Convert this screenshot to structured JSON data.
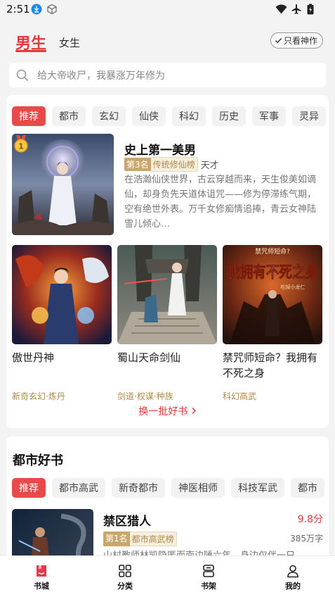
{
  "status_bar": {
    "time": "2:51"
  },
  "header": {
    "tab_male": "男生",
    "tab_female": "女生",
    "only_classics_button": "只看神作"
  },
  "search": {
    "placeholder": "给大帝收尸，我暴涨万年修为"
  },
  "recommend": {
    "categories": [
      "推荐",
      "都市",
      "玄幻",
      "仙侠",
      "科幻",
      "历史",
      "军事",
      "灵异"
    ],
    "featured": {
      "title": "史上第一美男",
      "rank": "第3名",
      "rank_list": "传统修仙榜",
      "author": "天才",
      "description": "在浩瀚仙侠世界，古云穿越而来，天生俊美如谪仙，却身负先天道体诅咒——修为停滞练气期，空有绝世外表。万千女修痴情追捧，青云女神陆雪儿倾心…",
      "rank_number": "1"
    },
    "books": [
      {
        "name": "傲世丹神",
        "tag": "新奇玄幻·炼丹"
      },
      {
        "name": "蜀山天命剑仙",
        "tag": "剑道·权谋·种族"
      },
      {
        "name": "禁咒师短命？我拥有不死之身",
        "tag": "科幻高武",
        "cover_text": "我拥有不死之身",
        "cover_subtext": "禁咒师短命?",
        "cover_author": "吃掉小龙仁"
      }
    ],
    "more_link": "换一批好书"
  },
  "urban": {
    "section_title": "都市好书",
    "categories": [
      "推荐",
      "都市高武",
      "新奇都市",
      "神医相师",
      "科技军武",
      "都市"
    ],
    "book": {
      "title": "禁区猎人",
      "score": "9.8分",
      "rank": "第1名",
      "rank_list": "都市高武榜",
      "words": "385万字",
      "description": "山村教师林凯隐匿而南边陲六年，身边仅伴一只"
    }
  },
  "bottom_nav": [
    {
      "label": "书城",
      "icon": "bookstore-icon"
    },
    {
      "label": "分类",
      "icon": "category-grid-icon"
    },
    {
      "label": "书架",
      "icon": "bookshelf-icon"
    },
    {
      "label": "我的",
      "icon": "profile-icon"
    }
  ],
  "colors": {
    "accent": "#e43a3a",
    "gold": "#b08a4a"
  }
}
